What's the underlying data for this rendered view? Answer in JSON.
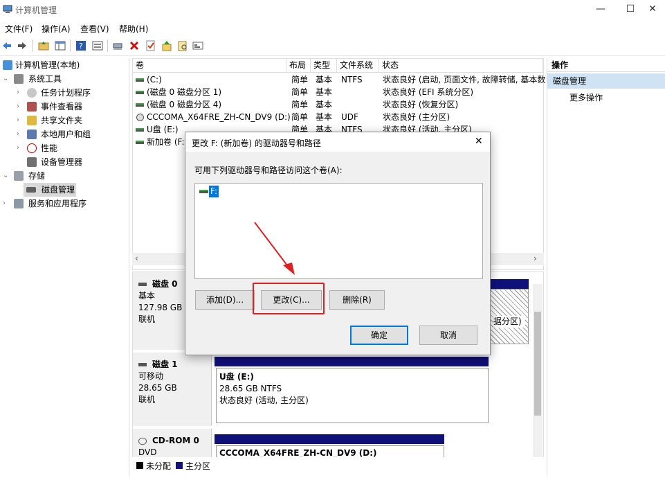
{
  "window": {
    "title": "计算机管理",
    "minimize": "—",
    "maximize": "☐",
    "close": "✕"
  },
  "menu": [
    "文件(F)",
    "操作(A)",
    "查看(V)",
    "帮助(H)"
  ],
  "toolbar": {
    "icons": [
      "back-icon",
      "forward-icon",
      "up-folder-icon",
      "show-hide-tree-icon",
      "help-icon",
      "properties-icon",
      "connect-icon",
      "delete-icon",
      "check-icon",
      "export-icon",
      "search-icon",
      "refresh-icon"
    ]
  },
  "tree": {
    "root": "计算机管理(本地)",
    "system_tools": "系统工具",
    "task_scheduler": "任务计划程序",
    "event_viewer": "事件查看器",
    "shared_folders": "共享文件夹",
    "local_users": "本地用户和组",
    "performance": "性能",
    "device_manager": "设备管理器",
    "storage": "存储",
    "disk_management": "磁盘管理",
    "services": "服务和应用程序"
  },
  "columns": [
    "卷",
    "布局",
    "类型",
    "文件系统",
    "状态"
  ],
  "volumes": [
    {
      "name": "(C:)",
      "layout": "简单",
      "type": "基本",
      "fs": "NTFS",
      "status": "状态良好 (启动, 页面文件, 故障转储, 基本数"
    },
    {
      "name": "(磁盘 0 磁盘分区 1)",
      "layout": "简单",
      "type": "基本",
      "fs": "",
      "status": "状态良好 (EFI 系统分区)"
    },
    {
      "name": "(磁盘 0 磁盘分区 4)",
      "layout": "简单",
      "type": "基本",
      "fs": "",
      "status": "状态良好 (恢复分区)"
    },
    {
      "name": "CCCOMA_X64FRE_ZH-CN_DV9 (D:)",
      "layout": "简单",
      "type": "基本",
      "fs": "UDF",
      "status": "状态良好 (主分区)"
    },
    {
      "name": "U盘 (E:)",
      "layout": "简单",
      "type": "基本",
      "fs": "NTFS",
      "status": "状态良好 (活动, 主分区)"
    },
    {
      "name": "新加卷 (F:)",
      "layout": "",
      "type": "",
      "fs": "",
      "status": ""
    }
  ],
  "disks": [
    {
      "name": "磁盘 0",
      "kind": "基本",
      "size": "127.98 GB",
      "state": "联机",
      "partition_tail": "据分区)"
    },
    {
      "name": "磁盘 1",
      "kind": "可移动",
      "size": "28.65 GB",
      "state": "联机",
      "part_name": "U盘  (E:)",
      "part_size": "28.65 GB NTFS",
      "part_status": "状态良好 (活动, 主分区)"
    },
    {
      "name": "CD-ROM 0",
      "kind": "DVD",
      "part_name": "CCCOMA_X64FRE_ZH-CN_DV9  (D:)"
    }
  ],
  "legend": {
    "unallocated": "未分配",
    "primary": "主分区"
  },
  "actions": {
    "header": "操作",
    "section": "磁盘管理",
    "more": "更多操作"
  },
  "dialog": {
    "title": "更改 F: (新加卷) 的驱动器号和路径",
    "label": "可用下列驱动器号和路径访问这个卷(A):",
    "list_item": "F:",
    "add": "添加(D)...",
    "change": "更改(C)...",
    "remove": "删除(R)",
    "ok": "确定",
    "cancel": "取消"
  },
  "colors": {
    "primary_partition": "#10107a",
    "highlight": "#e02020",
    "accent": "#0078d7"
  }
}
